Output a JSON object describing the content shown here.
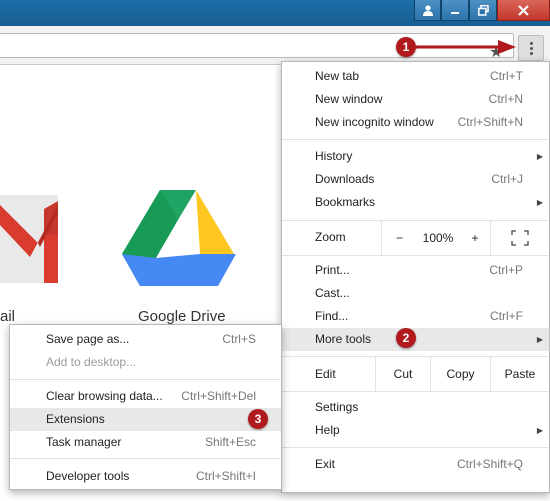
{
  "window": {
    "buttons": [
      {
        "name": "user-icon"
      },
      {
        "name": "minimize-icon"
      },
      {
        "name": "maximize-icon"
      },
      {
        "name": "close-icon"
      }
    ],
    "title_color": "#1d6fa8"
  },
  "toolbar": {
    "star_icon": "star-icon",
    "menu_icon": "vertical-dots-icon"
  },
  "apps": [
    {
      "label": "ail",
      "icon": "gmail-icon"
    },
    {
      "label": "Google Drive",
      "icon": "google-drive-icon"
    }
  ],
  "markers": [
    "1",
    "2",
    "3"
  ],
  "menu": {
    "new_tab": {
      "label": "New tab",
      "shortcut": "Ctrl+T"
    },
    "new_window": {
      "label": "New window",
      "shortcut": "Ctrl+N"
    },
    "new_incognito": {
      "label": "New incognito window",
      "shortcut": "Ctrl+Shift+N"
    },
    "history": {
      "label": "History"
    },
    "downloads": {
      "label": "Downloads",
      "shortcut": "Ctrl+J"
    },
    "bookmarks": {
      "label": "Bookmarks"
    },
    "zoom": {
      "label": "Zoom",
      "minus": "−",
      "level": "100%",
      "plus": "+"
    },
    "print": {
      "label": "Print...",
      "shortcut": "Ctrl+P"
    },
    "cast": {
      "label": "Cast..."
    },
    "find": {
      "label": "Find...",
      "shortcut": "Ctrl+F"
    },
    "more_tools": {
      "label": "More tools"
    },
    "edit": {
      "label": "Edit",
      "cut": "Cut",
      "copy": "Copy",
      "paste": "Paste"
    },
    "settings": {
      "label": "Settings"
    },
    "help": {
      "label": "Help"
    },
    "exit": {
      "label": "Exit",
      "shortcut": "Ctrl+Shift+Q"
    }
  },
  "submenu": {
    "save_page": {
      "label": "Save page as...",
      "shortcut": "Ctrl+S"
    },
    "add_desktop": {
      "label": "Add to desktop..."
    },
    "clear_data": {
      "label": "Clear browsing data...",
      "shortcut": "Ctrl+Shift+Del"
    },
    "extensions": {
      "label": "Extensions"
    },
    "task_manager": {
      "label": "Task manager",
      "shortcut": "Shift+Esc"
    },
    "dev_tools": {
      "label": "Developer tools",
      "shortcut": "Ctrl+Shift+I"
    }
  },
  "colors": {
    "marker": "#b11a1d",
    "highlight": "#e8e8e8"
  }
}
